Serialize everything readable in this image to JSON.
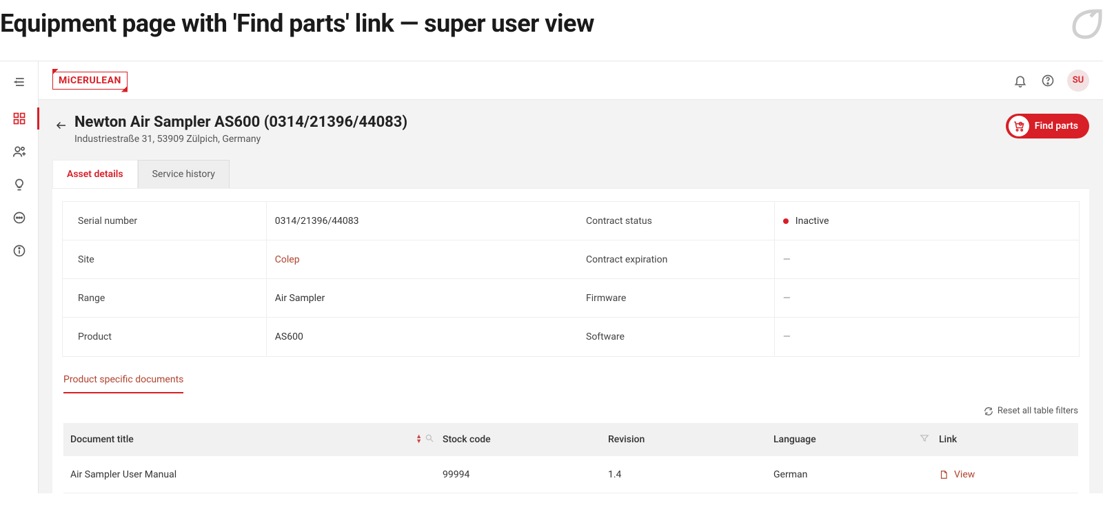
{
  "page_heading": "Equipment page with 'Find parts' link — super user view",
  "brand": {
    "prefix": "Mi",
    "name": "CERULEAN"
  },
  "user_initials": "SU",
  "equipment": {
    "title": "Newton Air Sampler AS600 (0314/21396/44083)",
    "address": "Industriestraße 31, 53909 Zülpich, Germany"
  },
  "buttons": {
    "find_parts": "Find parts"
  },
  "tabs": {
    "asset_details": "Asset details",
    "service_history": "Service history"
  },
  "details_left": [
    {
      "label": "Serial number",
      "value": "0314/21396/44083"
    },
    {
      "label": "Site",
      "value": "Colep",
      "link": true
    },
    {
      "label": "Range",
      "value": "Air Sampler"
    },
    {
      "label": "Product",
      "value": "AS600"
    }
  ],
  "details_right": [
    {
      "label": "Contract status",
      "value": "Inactive",
      "status": true
    },
    {
      "label": "Contract expiration",
      "value": "—"
    },
    {
      "label": "Firmware",
      "value": "—"
    },
    {
      "label": "Software",
      "value": "—"
    }
  ],
  "doc_section_tab": "Product specific documents",
  "reset_filters_label": "Reset all table filters",
  "doc_columns": {
    "title": "Document title",
    "stock": "Stock code",
    "revision": "Revision",
    "language": "Language",
    "link": "Link"
  },
  "doc_rows": [
    {
      "title": "Air Sampler User Manual",
      "stock": "99994",
      "revision": "1.4",
      "language": "German",
      "link_label": "View"
    }
  ]
}
